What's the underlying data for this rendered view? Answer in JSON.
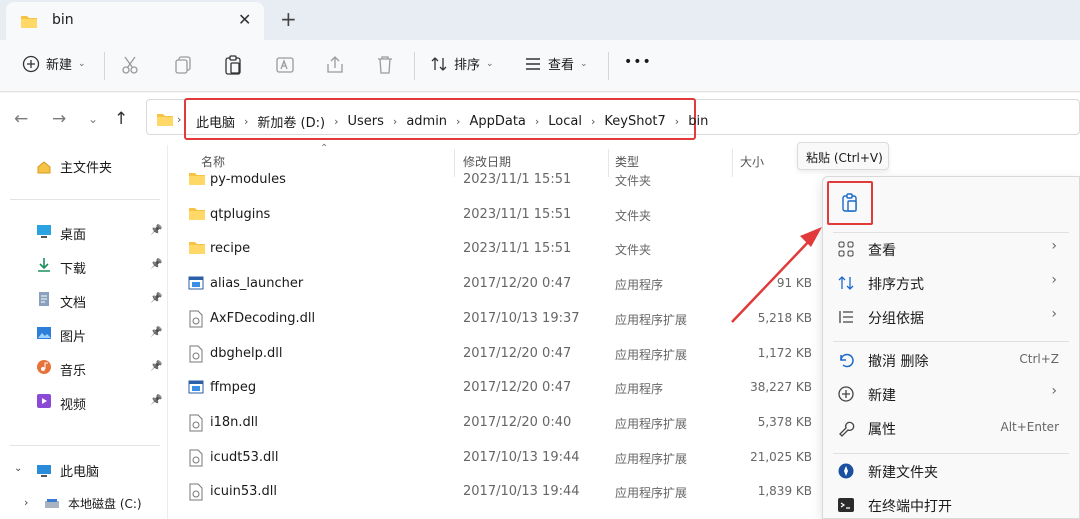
{
  "tab": {
    "title": "bin",
    "close": "✕",
    "new_tab": "+"
  },
  "toolbar": {
    "new_label": "新建",
    "sort_label": "排序",
    "view_label": "查看",
    "more_label": "•••"
  },
  "address": {
    "crumbs": [
      "此电脑",
      "新加卷 (D:)",
      "Users",
      "admin",
      "AppData",
      "Local",
      "KeyShot7",
      "bin"
    ]
  },
  "sidebar": {
    "home": "主文件夹",
    "quick": [
      {
        "label": "桌面",
        "icon": "desktop-icon"
      },
      {
        "label": "下载",
        "icon": "download-icon"
      },
      {
        "label": "文档",
        "icon": "document-icon"
      },
      {
        "label": "图片",
        "icon": "picture-icon"
      },
      {
        "label": "音乐",
        "icon": "music-icon"
      },
      {
        "label": "视频",
        "icon": "video-icon"
      }
    ],
    "this_pc": "此电脑",
    "local_disk": "本地磁盘 (C:)"
  },
  "columns": {
    "name": "名称",
    "date": "修改日期",
    "type": "类型",
    "size": "大小"
  },
  "files": [
    {
      "name": "py-modules",
      "date": "2023/11/1 15:51",
      "type": "文件夹",
      "size": "",
      "icon": "folder"
    },
    {
      "name": "qtplugins",
      "date": "2023/11/1 15:51",
      "type": "文件夹",
      "size": "",
      "icon": "folder"
    },
    {
      "name": "recipe",
      "date": "2023/11/1 15:51",
      "type": "文件夹",
      "size": "",
      "icon": "folder"
    },
    {
      "name": "alias_launcher",
      "date": "2017/12/20 0:47",
      "type": "应用程序",
      "size": "91 KB",
      "icon": "app"
    },
    {
      "name": "AxFDecoding.dll",
      "date": "2017/10/13 19:37",
      "type": "应用程序扩展",
      "size": "5,218 KB",
      "icon": "dll"
    },
    {
      "name": "dbghelp.dll",
      "date": "2017/12/20 0:47",
      "type": "应用程序扩展",
      "size": "1,172 KB",
      "icon": "dll"
    },
    {
      "name": "ffmpeg",
      "date": "2017/12/20 0:47",
      "type": "应用程序",
      "size": "38,227 KB",
      "icon": "app"
    },
    {
      "name": "i18n.dll",
      "date": "2017/12/20 0:40",
      "type": "应用程序扩展",
      "size": "5,378 KB",
      "icon": "dll"
    },
    {
      "name": "icudt53.dll",
      "date": "2017/10/13 19:44",
      "type": "应用程序扩展",
      "size": "21,025 KB",
      "icon": "dll"
    },
    {
      "name": "icuin53.dll",
      "date": "2017/10/13 19:44",
      "type": "应用程序扩展",
      "size": "1,839 KB",
      "icon": "dll"
    }
  ],
  "tooltip": "粘贴 (Ctrl+V)",
  "context_menu": {
    "items": [
      {
        "label": "查看",
        "shortcut": "",
        "submenu": true,
        "icon": "grid-icon"
      },
      {
        "label": "排序方式",
        "shortcut": "",
        "submenu": true,
        "icon": "sort-icon"
      },
      {
        "label": "分组依据",
        "shortcut": "",
        "submenu": true,
        "icon": "group-icon"
      },
      {
        "label": "撤消 删除",
        "shortcut": "Ctrl+Z",
        "submenu": false,
        "icon": "undo-icon"
      },
      {
        "label": "新建",
        "shortcut": "",
        "submenu": true,
        "icon": "new-icon"
      },
      {
        "label": "属性",
        "shortcut": "Alt+Enter",
        "submenu": false,
        "icon": "wrench-icon"
      },
      {
        "label": "新建文件夹",
        "shortcut": "",
        "submenu": false,
        "icon": "new-folder-icon"
      },
      {
        "label": "在终端中打开",
        "shortcut": "",
        "submenu": false,
        "icon": "terminal-icon"
      }
    ],
    "submenu_glyph": "›"
  },
  "colors": {
    "accent_red": "#e03a3a",
    "folder": "#f6c445",
    "link_blue": "#1b6ac9"
  }
}
